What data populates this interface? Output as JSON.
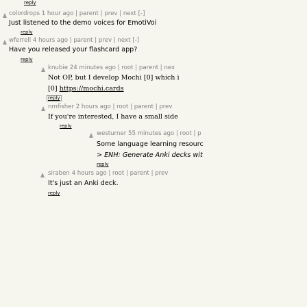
{
  "top_reply": "reply",
  "comments": [
    {
      "user": "colordrops",
      "age": "1 hour ago",
      "links": [
        "parent",
        "prev",
        "next"
      ],
      "toggle": "[-]",
      "lines": [
        "Just listened to the demo voices for EmotiVoi"
      ],
      "reply": "reply"
    },
    {
      "user": "wferrell",
      "age": "4 hours ago",
      "links": [
        "parent",
        "prev",
        "next"
      ],
      "toggle": "[-]",
      "lines": [
        "Have you released your flashcard app?"
      ],
      "reply": "reply"
    },
    {
      "user": "knubie",
      "age": "24 minutes ago",
      "links": [
        "root",
        "parent",
        "nex"
      ],
      "lines": [
        "Not OP, but I develop Mochi [0] which i"
      ],
      "link_line_prefix": "[0] ",
      "link_line_url": "https://mochi.cards",
      "reply": "reply"
    },
    {
      "user": "nmfisher",
      "age": "2 hours ago",
      "links": [
        "root",
        "parent",
        "prev"
      ],
      "lines": [
        "If you're interested, I have a small side"
      ],
      "reply": "reply"
    },
    {
      "user": "westurner",
      "age": "55 minutes ago",
      "links": [
        "root",
        "p"
      ],
      "lines": [
        "Some language learning resourc",
        "> ENH: Generate Anki decks wit"
      ],
      "reply": "reply"
    },
    {
      "user": "siraben",
      "age": "4 hours ago",
      "links": [
        "root",
        "parent",
        "prev"
      ],
      "lines": [
        "It's just an Anki deck."
      ],
      "reply": "reply"
    }
  ]
}
